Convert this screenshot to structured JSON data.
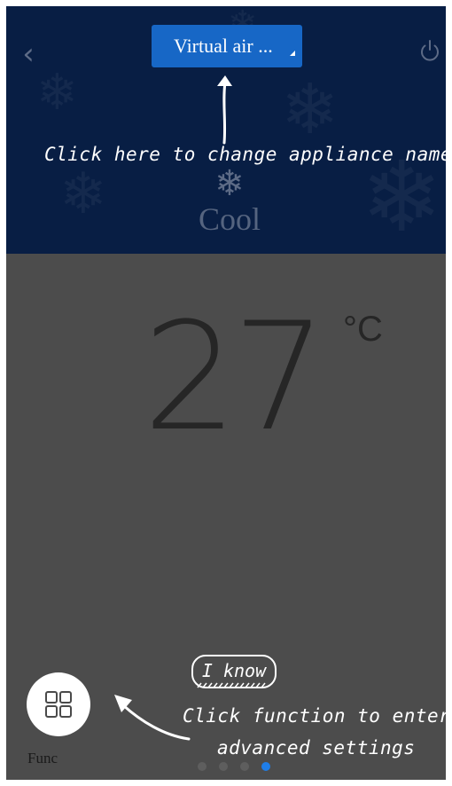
{
  "header": {
    "appliance_name": "Virtual air ...",
    "mode_label": "Cool",
    "icons": {
      "back": "chevron-left-icon",
      "power": "power-icon",
      "mode": "snowflake-icon",
      "name_dropdown": "caret-icon"
    }
  },
  "temperature": {
    "value": "27",
    "unit": "°C"
  },
  "func": {
    "label": "Func",
    "icon": "grid-icon"
  },
  "pager": {
    "count": 4,
    "active_index": 3
  },
  "guide": {
    "name_hint": "Click here to change appliance name",
    "func_hint_line1": "Click function to enter",
    "func_hint_line2": "advanced settings",
    "dismiss_label": "I know"
  },
  "colors": {
    "header_bg": "#081e44",
    "body_bg": "#4c4c4c",
    "name_button": "#1767c6",
    "active_dot": "#1f7ee8"
  }
}
